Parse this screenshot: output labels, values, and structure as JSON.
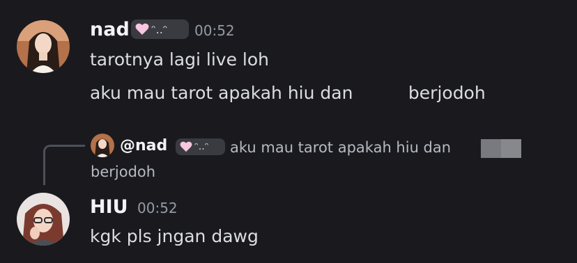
{
  "messages": [
    {
      "author": "nad",
      "tag_kaomoji": "ᵔ..ᵔ",
      "time": "00:52",
      "lines": [
        "tarotnya lagi live loh",
        "aku mau tarot apakah hiu dan          berjodoh"
      ]
    },
    {
      "reply": {
        "mention": "@nad",
        "tag_kaomoji": "ᵔ..ᵔ",
        "text": "aku mau tarot apakah hiu dan",
        "text_cont": "berjodoh"
      },
      "author": "HIU",
      "time": "00:52",
      "lines": [
        "kgk pls jngan dawg"
      ]
    }
  ],
  "colors": {
    "background": "#1a1a1e",
    "username": "#f2f3f5",
    "text": "#dbdee1",
    "muted": "#949ba4",
    "heart": "#f7c6e0"
  }
}
